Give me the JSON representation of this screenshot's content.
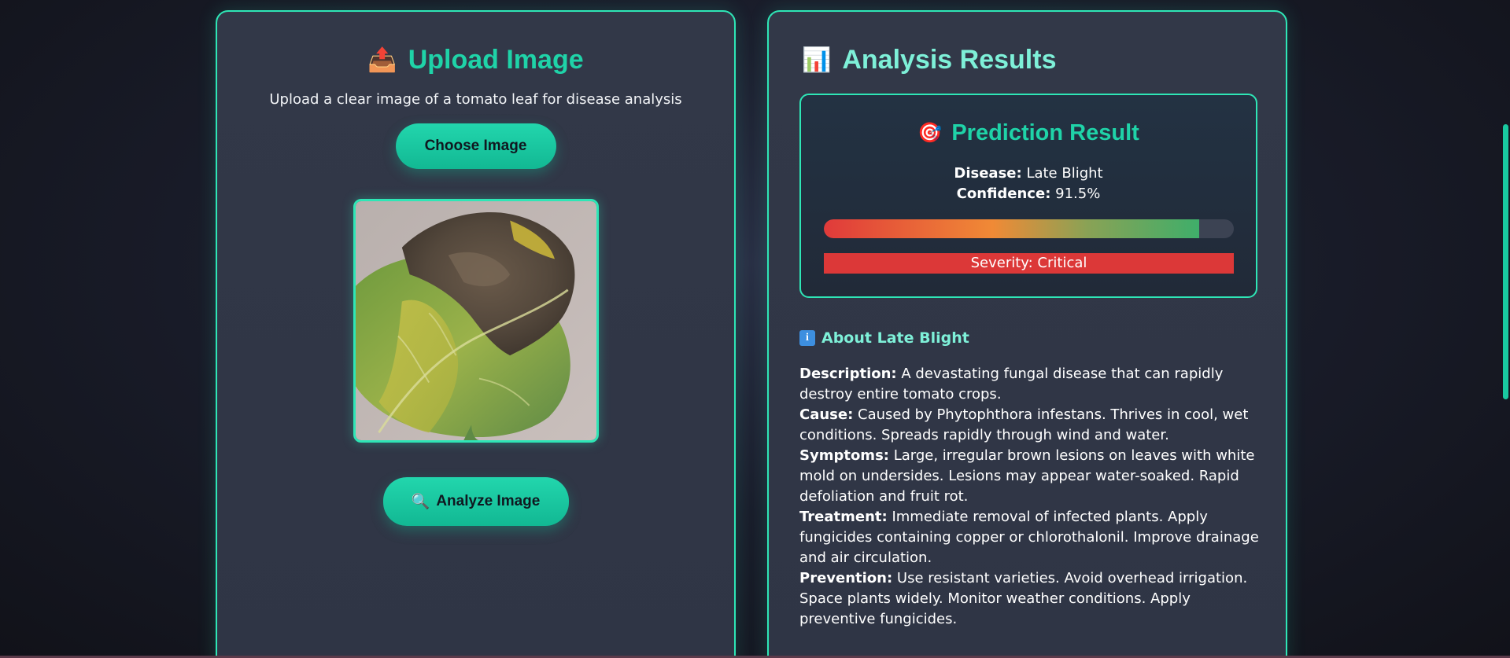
{
  "upload": {
    "title": "Upload Image",
    "title_icon": "upload-tray-icon",
    "subtitle": "Upload a clear image of a tomato leaf for disease analysis",
    "choose_label": "Choose Image",
    "analyze_label": "Analyze Image",
    "analyze_icon": "magnifier-icon"
  },
  "results": {
    "title": "Analysis Results",
    "title_icon": "bar-chart-icon",
    "prediction": {
      "title": "Prediction Result",
      "title_icon": "target-icon",
      "disease_label": "Disease:",
      "disease_value": "Late Blight",
      "confidence_label": "Confidence:",
      "confidence_value": "91.5%",
      "confidence_fraction": 0.915,
      "severity_text": "Severity: Critical",
      "severity_color": "#dc3838"
    },
    "about": {
      "title": "About Late Blight",
      "title_icon": "info-icon",
      "items": [
        {
          "label": "Description:",
          "text": "A devastating fungal disease that can rapidly destroy entire tomato crops."
        },
        {
          "label": "Cause:",
          "text": "Caused by Phytophthora infestans. Thrives in cool, wet conditions. Spreads rapidly through wind and water."
        },
        {
          "label": "Symptoms:",
          "text": "Large, irregular brown lesions on leaves with white mold on undersides. Lesions may appear water-soaked. Rapid defoliation and fruit rot."
        },
        {
          "label": "Treatment:",
          "text": "Immediate removal of infected plants. Apply fungicides containing copper or chlorothalonil. Improve drainage and air circulation."
        },
        {
          "label": "Prevention:",
          "text": "Use resistant varieties. Avoid overhead irrigation. Space plants widely. Monitor weather conditions. Apply preventive fungicides."
        }
      ]
    }
  },
  "colors": {
    "accent": "#2ee6b6",
    "accent_text": "#1fd3a8",
    "heading_light": "#7ef0d8",
    "panel_bg": "#323848"
  }
}
